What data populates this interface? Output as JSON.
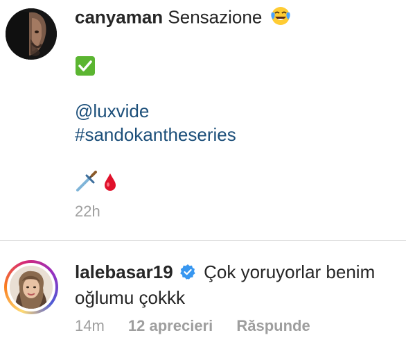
{
  "post": {
    "username": "canyaman",
    "caption_text": "Sensazione",
    "mention": "@luxvide",
    "hashtag": "#sandokantheseries",
    "time": "22h",
    "emojis": [
      "face-with-tears-of-joy-icon",
      "check-mark-button-icon",
      "dagger-icon",
      "drop-of-blood-icon"
    ]
  },
  "comment": {
    "username": "lalebasar19",
    "verified": true,
    "text_line1": "Çok yoruyorlar benim",
    "text_line2": "oğlumu çokkk",
    "time": "14m",
    "likes_label": "12 aprecieri",
    "reply_label": "Răspunde"
  },
  "colors": {
    "link": "#1c4f7a",
    "meta": "#9e9e9e",
    "text": "#262626",
    "verified": "#3897f0",
    "divider": "#dbdbdb"
  }
}
